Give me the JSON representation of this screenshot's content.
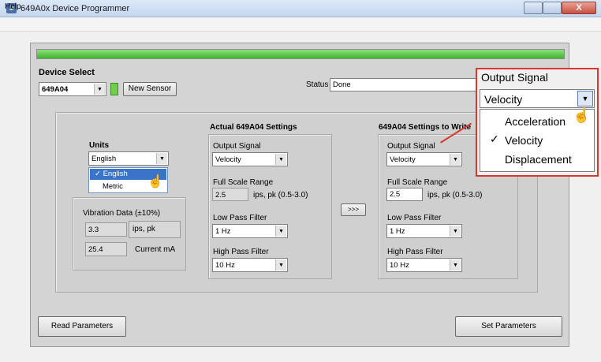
{
  "window": {
    "title": "649A0x Device Programmer",
    "close_label": "X"
  },
  "menu": {
    "help": "Help"
  },
  "progress": {
    "fraction": 1.0
  },
  "device_select": {
    "label": "Device Select",
    "value": "649A04",
    "new_sensor_label": "New Sensor"
  },
  "status": {
    "label": "Status",
    "value": "Done"
  },
  "units": {
    "label": "Units",
    "value": "English",
    "options": [
      "English",
      "Metric"
    ],
    "selected_option": "✓ English"
  },
  "vibration": {
    "label": "Vibration Data (±10%)",
    "value1": "3.3",
    "unit1": "ips, pk",
    "value2": "25.4",
    "unit2": "Current mA"
  },
  "actual": {
    "title": "Actual 649A04 Settings",
    "output_signal_label": "Output Signal",
    "output_signal": "Velocity",
    "fsr_label": "Full Scale Range",
    "fsr_value": "2.5",
    "fsr_unit": "ips, pk (0.5-3.0)",
    "lpf_label": "Low Pass Filter",
    "lpf_value": "1 Hz",
    "hpf_label": "High Pass Filter",
    "hpf_value": "10 Hz"
  },
  "copy_button": ">>>",
  "write": {
    "title": "649A04 Settings to Write",
    "output_signal_label": "Output Signal",
    "output_signal": "Velocity",
    "fsr_label": "Full Scale Range",
    "fsr_value": "2.5",
    "fsr_unit": "ips, pk (0.5-3.0)",
    "lpf_label": "Low Pass Filter",
    "lpf_value": "1 Hz",
    "hpf_label": "High Pass Filter",
    "hpf_value": "10 Hz"
  },
  "buttons": {
    "read": "Read Parameters",
    "set": "Set Parameters"
  },
  "callout": {
    "title": "Output Signal",
    "value": "Velocity",
    "options": [
      "Acceleration",
      "Velocity",
      "Displacement"
    ],
    "check": "✓"
  },
  "colors": {
    "accent_red": "#d9372b",
    "progress_green": "#3fb52d",
    "selection_blue": "#3a74c9"
  }
}
